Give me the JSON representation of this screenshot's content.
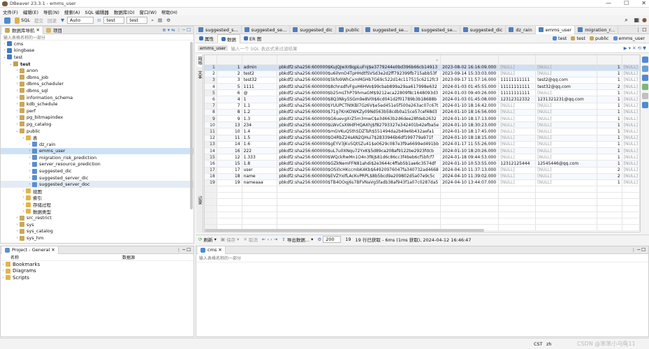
{
  "window": {
    "title": "DBeaver 23.3.1 - emms_user"
  },
  "menu": [
    "文件(F)",
    "编辑(E)",
    "导航(N)",
    "搜索(A)",
    "SQL 编辑器",
    "数据库(D)",
    "窗口(W)",
    "帮助(H)"
  ],
  "toolbar": {
    "sql": "SQL",
    "commit": "提交",
    "rollback": "回滚",
    "mode": "Auto",
    "conn": "test",
    "schema": "test"
  },
  "nav": {
    "tab1": "数据库导航",
    "tab2": "项目",
    "filter": "输入表格名称的一部分"
  },
  "tree": [
    {
      "label": "cms",
      "lvl": 0,
      "arrow": "›",
      "color": "#3f7ac6"
    },
    {
      "label": "kingbase",
      "lvl": 0,
      "arrow": "›",
      "color": "#3f7ac6"
    },
    {
      "label": "test",
      "lvl": 0,
      "arrow": "⌄",
      "color": "#3f7ac6"
    },
    {
      "label": "test",
      "lvl": 1,
      "arrow": "⌄",
      "color": "#c0a050",
      "bold": true
    },
    {
      "label": "anon",
      "lvl": 2,
      "arrow": "›",
      "color": "#caa85a"
    },
    {
      "label": "dbms_job",
      "lvl": 2,
      "arrow": "›",
      "color": "#caa85a"
    },
    {
      "label": "dbms_scheduler",
      "lvl": 2,
      "arrow": "›",
      "color": "#caa85a"
    },
    {
      "label": "dbms_sql",
      "lvl": 2,
      "arrow": "›",
      "color": "#caa85a"
    },
    {
      "label": "information_schema",
      "lvl": 2,
      "arrow": "›",
      "color": "#caa85a"
    },
    {
      "label": "kdb_schedule",
      "lvl": 2,
      "arrow": "›",
      "color": "#caa85a"
    },
    {
      "label": "perf",
      "lvl": 2,
      "arrow": "›",
      "color": "#caa85a"
    },
    {
      "label": "pg_bitmapindex",
      "lvl": 2,
      "arrow": "›",
      "color": "#caa85a"
    },
    {
      "label": "pg_catalog",
      "lvl": 2,
      "arrow": "›",
      "color": "#caa85a"
    },
    {
      "label": "public",
      "lvl": 2,
      "arrow": "⌄",
      "color": "#caa85a"
    },
    {
      "label": "表",
      "lvl": 3,
      "arrow": "⌄",
      "color": "#e2b44a"
    },
    {
      "label": "dz_rain",
      "lvl": 4,
      "arrow": "›",
      "color": "#5b8ed0"
    },
    {
      "label": "emms_user",
      "lvl": 4,
      "arrow": "›",
      "color": "#5b8ed0",
      "sel": true
    },
    {
      "label": "migration_risk_prediction",
      "lvl": 4,
      "arrow": "›",
      "color": "#5b8ed0"
    },
    {
      "label": "server_resource_prediction",
      "lvl": 4,
      "arrow": "›",
      "color": "#5b8ed0"
    },
    {
      "label": "suggested_dic",
      "lvl": 4,
      "arrow": "›",
      "color": "#5b8ed0"
    },
    {
      "label": "suggested_server_dic",
      "lvl": 4,
      "arrow": "›",
      "color": "#5b8ed0"
    },
    {
      "label": "suggested_server_doc",
      "lvl": 4,
      "arrow": "›",
      "color": "#5b8ed0",
      "hl": true
    },
    {
      "label": "视图",
      "lvl": 3,
      "arrow": "›",
      "color": "#e2b44a"
    },
    {
      "label": "索引",
      "lvl": 3,
      "arrow": "›",
      "color": "#e2b44a"
    },
    {
      "label": "存储过程",
      "lvl": 3,
      "arrow": "›",
      "color": "#e2b44a"
    },
    {
      "label": "数据类型",
      "lvl": 3,
      "arrow": "›",
      "color": "#e2b44a"
    },
    {
      "label": "src_restrict",
      "lvl": 2,
      "arrow": "›",
      "color": "#caa85a"
    },
    {
      "label": "sys",
      "lvl": 2,
      "arrow": "›",
      "color": "#caa85a"
    },
    {
      "label": "sys_catalog",
      "lvl": 2,
      "arrow": "›",
      "color": "#caa85a"
    },
    {
      "label": "sys_hm",
      "lvl": 2,
      "arrow": "›",
      "color": "#caa85a"
    }
  ],
  "project": {
    "tab": "Project - General",
    "col1": "名称",
    "col2": "数据源",
    "items": [
      "Bookmarks",
      "Diagrams",
      "Scripts"
    ]
  },
  "editor_tabs": [
    "suggested_s...",
    "suggested_se...",
    "suggested_dic",
    "public",
    "suggested_se...",
    "suggested_se...",
    "suggested_dic",
    "dz_rain",
    "emms_user",
    "migration_r..."
  ],
  "editor_tabs_selected": 8,
  "subtabs": {
    "props": "属性",
    "data": "数据",
    "er": "ER 图",
    "conn": "test",
    "schema": "test",
    "db": "public",
    "table": "emms_user"
  },
  "filterbar": {
    "table": "emms_user",
    "placeholder": "输入一个 SQL 表达式来过滤结果"
  },
  "vtabs": [
    "网格",
    "文本",
    "记录"
  ],
  "grid": {
    "rows": [
      [
        "1",
        "1",
        "admin",
        "pbkdf2:sha256:600000$KujQJwXrBqpLuFnj$e3779244e0bd396b66cb14913",
        "2023-08-02 16:16:09.000",
        "[NULL]",
        "[NULL]",
        "1",
        "[NULL]"
      ],
      [
        "2",
        "2",
        "test2",
        "pbkdf2:sha256:600000$u6ihmO4TpHHdtfSVSd3e2d2ff792399fb715abb53f",
        "2023-09-14 15:33:03.000",
        "[NULL]",
        "[NULL]",
        "1",
        "[NULL]"
      ],
      [
        "3",
        "3",
        "test32",
        "pbkdf2:sha256:600000$5kfo9WhCxmMGHb7G69c522d14c117515c6212fc3",
        "2023-09-17 11:57:16.000",
        "11111111111",
        "test2@qq.com",
        "1",
        "[NULL]"
      ],
      [
        "4",
        "5",
        "1111",
        "pbkdf2:sha256:600000$8chnsdfvFguH6HVo$99cbab899a29aa617998e632",
        "2024-01-03 01:45:55.000",
        "11111111111",
        "test32@qq.com",
        "2",
        "[NULL]"
      ],
      [
        "5",
        "6",
        "@",
        "pbkdf2:sha256:600000$b25mLThP79hmaGM$9212aca22809f8c1648093d3",
        "2024-01-03 09:40:26.000",
        "11111111111",
        "[NULL]",
        "1",
        "[NULL]"
      ],
      [
        "6",
        "4",
        "1",
        "pbkdf2:sha256:600000$8Q3Nky5SGm9e8V0I$6cd041d2f01789b3b18688b",
        "2024-01-03 01:45:08.000",
        "12312312332",
        "1231321231@qq.com",
        "1",
        "[NULL]"
      ],
      [
        "7",
        "7",
        "1.1",
        "pbkdf2:sha256:600000$YUUPCTNtKBl7Gz6V$e5ed451e5f500e263ac07c67t",
        "2024-01-10 18:16:42.000",
        "[NULL]",
        "[NULL]",
        "1",
        "[NULL]"
      ],
      [
        "8",
        "8",
        "1.2",
        "pbkdf2:sha256:600000$71g7KnKOWKZy09Nd563b58cdb0a15ce57cef48d3",
        "2024-01-10 18:16:56.000",
        "[NULL]",
        "[NULL]",
        "1",
        "[NULL]"
      ],
      [
        "9",
        "9",
        "1.3",
        "pbkdf2:sha256:600000$G6uevgXrZ5m3mwC$e3d663b2d6dee28fdeb2632",
        "2024-01-10 18:17:13.000",
        "[NULL]",
        "[NULL]",
        "1",
        "[NULL]"
      ],
      [
        "10",
        "13",
        "234",
        "pbkdf2:sha256:600000$LWvCsXWdFHQAXhj$f82793327e342401b42efba5e",
        "2024-01-10 18:30:23.000",
        "[NULL]",
        "[NULL]",
        "1",
        "[NULL]"
      ],
      [
        "11",
        "10",
        "1.4",
        "pbkdf2:sha256:600000$mGVKuQ5thSDZTsR$551494da2b49e6b432aefa1",
        "2024-01-10 18:17:45.000",
        "[NULL]",
        "[NULL]",
        "1",
        "[NULL]"
      ],
      [
        "12",
        "11",
        "1.5",
        "pbkdf2:sha256:600000$O4RbZ24sAN2QHui7$2833946b6df199779a971f",
        "2024-01-10 18:18:15.000",
        "[NULL]",
        "[NULL]",
        "1",
        "[NULL]"
      ],
      [
        "13",
        "14",
        "1.6",
        "pbkdf2:sha256:600000$gEYV3jKvSQtSZu41$e0629c087e3f9a6699ed491bb",
        "2024-01-17 11:55:26.000",
        "[NULL]",
        "[NULL]",
        "1",
        "[NULL]"
      ],
      [
        "14",
        "16",
        "222",
        "pbkdf2:sha256:600000$uL7u0XNqu72YxK$5d89ca208af9122be2923fdcb",
        "2024-01-10 18:20:26.000",
        "[NULL]",
        "[NULL]",
        "1",
        "[NULL]"
      ],
      [
        "15",
        "12",
        "1.333",
        "pbkdf2:sha256:600000$WQckRwMn1O4n3f8j$81d6c86cc3f4beb6cf5bfcf7",
        "2024-01-18 09:44:53.000",
        "[NULL]",
        "[NULL]",
        "1",
        "[NULL]"
      ],
      [
        "16",
        "15",
        "1.8",
        "pbkdf2:sha256:600000$GZkNemFFN81ahdi$2e3644c4ffab5b1ae6c3574df",
        "2024-01-10 10:53:55.000",
        "12312125444",
        "12545446@qq.com",
        "1",
        "[NULL]"
      ],
      [
        "17",
        "17",
        "user",
        "pbkdf2:sha256:600000$OSi0cHKccmbK4Kb$64920976047fa340732ad4668",
        "2024-04-10 11:37:13.000",
        "[NULL]",
        "[NULL]",
        "2",
        "[NULL]"
      ],
      [
        "18",
        "18",
        "name",
        "pbkdf2:sha256:600000$EVZYxIfLAcKvPRPL$8b5bcd9a209802d5a07e9c5c",
        "2024-04-10 11:39:02.000",
        "[NULL]",
        "[NULL]",
        "2",
        "[NULL]"
      ],
      [
        "19",
        "19",
        "nameaaa",
        "pbkdf2:sha256:600000$TB4OOqj6s7BFVNaVg5fadb38af943f1a07c0287da5",
        "2024-04-10 13:44:07.000",
        "[NULL]",
        "[NULL]",
        "1",
        "[NULL]"
      ]
    ]
  },
  "statusbar": {
    "refresh": "刷新",
    "save": "保存",
    "cancel": "取消",
    "export": "导出数据...",
    "limit": "200",
    "count": "19",
    "summary": "19 行已获取 - 6ms (1ms 获取), 2024-04-12 16:46:47"
  },
  "console": {
    "tab": "cms",
    "filter": "输入表格名称的一部分"
  },
  "appstatus": {
    "tz": "CST",
    "locale": "zh",
    "watermark": "CSDN @笨笨小乌龟11"
  }
}
